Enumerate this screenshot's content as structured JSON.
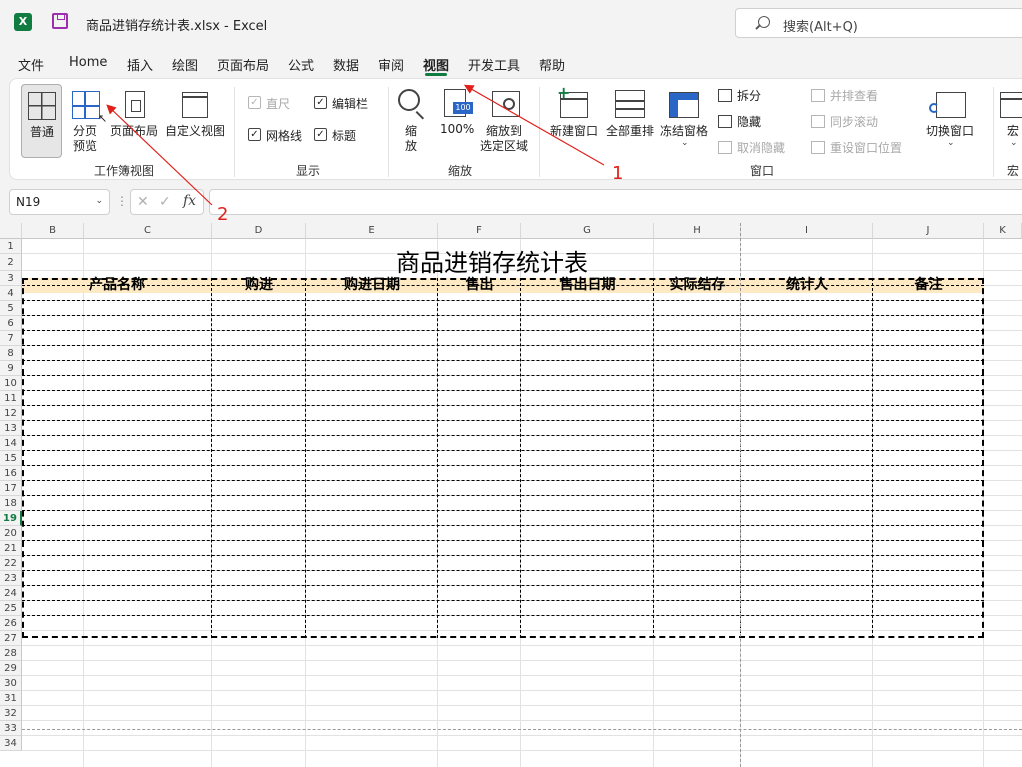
{
  "titlebar": {
    "app_icon": "excel-icon",
    "app_icon_letter": "X",
    "save_icon": "save-icon",
    "document_title": "商品进销存统计表.xlsx  -  Excel",
    "search_placeholder": "搜索(Alt+Q)"
  },
  "menu": {
    "items": [
      "文件",
      "Home",
      "插入",
      "绘图",
      "页面布局",
      "公式",
      "数据",
      "审阅",
      "视图",
      "开发工具",
      "帮助"
    ],
    "active": "视图"
  },
  "ribbon": {
    "workbook_views": {
      "label": "工作簿视图",
      "normal": "普通",
      "page_break_preview_1": "分页",
      "page_break_preview_2": "预览",
      "page_layout": "页面布局",
      "custom_views": "自定义视图"
    },
    "show": {
      "label": "显示",
      "ruler": "直尺",
      "formula_bar": "编辑栏",
      "gridlines": "网格线",
      "headings": "标题",
      "check": "✓"
    },
    "zoom": {
      "label": "缩放",
      "zoom_1": "缩",
      "zoom_2": "放",
      "hundred": "100%",
      "hundred_badge": "100",
      "to_selection_1": "缩放到",
      "to_selection_2": "选定区域"
    },
    "window": {
      "label": "窗口",
      "new_window": "新建窗口",
      "arrange_all": "全部重排",
      "freeze_panes": "冻结窗格",
      "split": "拆分",
      "hide": "隐藏",
      "unhide": "取消隐藏",
      "side_by_side": "并排查看",
      "sync_scroll": "同步滚动",
      "reset_position": "重设窗口位置",
      "switch_windows": "切换窗口"
    },
    "macros": {
      "label": "宏",
      "macros": "宏"
    },
    "caret": "⌄"
  },
  "formula_bar": {
    "name_box": "N19",
    "caret": "⌄",
    "more": "⋮",
    "cancel": "✕",
    "enter": "✓",
    "fx": "fx",
    "value": ""
  },
  "sheet": {
    "columns": [
      "B",
      "C",
      "D",
      "E",
      "F",
      "G",
      "H",
      "I",
      "J",
      "K"
    ],
    "rows": [
      "1",
      "2",
      "3",
      "4",
      "5",
      "6",
      "7",
      "8",
      "9",
      "10",
      "11",
      "12",
      "13",
      "14",
      "15",
      "16",
      "17",
      "18",
      "19",
      "20",
      "21",
      "22",
      "23",
      "24",
      "25",
      "26",
      "27",
      "28",
      "29",
      "30",
      "31",
      "32",
      "33",
      "34"
    ],
    "selected_row": "19",
    "title": "商品进销存统计表",
    "headers": [
      "产品名称",
      "购进",
      "购进日期",
      "售出",
      "售出日期",
      "实际结存",
      "统计人",
      "备注"
    ],
    "header_fill": "#fde9c4"
  },
  "annotations": {
    "label_1": "1",
    "label_2": "2",
    "color": "#e0211b"
  }
}
